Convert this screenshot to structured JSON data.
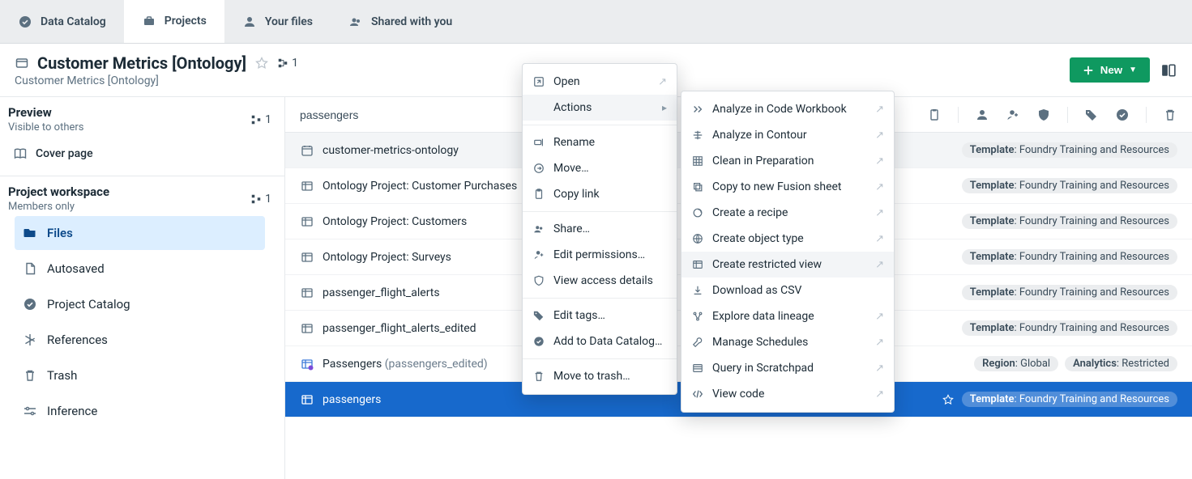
{
  "top_tabs": {
    "data_catalog": "Data Catalog",
    "projects": "Projects",
    "your_files": "Your files",
    "shared": "Shared with you"
  },
  "header": {
    "title": "Customer Metrics [Ontology]",
    "breadcrumb": "Customer Metrics [Ontology]",
    "forks_count": "1",
    "new_label": "New"
  },
  "sidebar": {
    "preview_heading": "Preview",
    "preview_sub": "Visible to others",
    "preview_chip": "1",
    "cover_page": "Cover page",
    "workspace_heading": "Project workspace",
    "workspace_sub": "Members only",
    "workspace_chip": "1",
    "nav": {
      "files": "Files",
      "autosaved": "Autosaved",
      "catalog": "Project Catalog",
      "references": "References",
      "trash": "Trash",
      "inference": "Inference"
    }
  },
  "content": {
    "search_placeholder": "passengers",
    "template_prefix": "Template",
    "template_value": "Foundry Training and Resources",
    "region_prefix": "Region",
    "region_value": "Global",
    "analytics_prefix": "Analytics",
    "analytics_value": "Restricted",
    "rows": {
      "r0": "customer-metrics-ontology",
      "r1": "Ontology Project: Customer Purchases",
      "r2": "Ontology Project: Customers",
      "r3": "Ontology Project: Surveys",
      "r4": "passenger_flight_alerts",
      "r5": "passenger_flight_alerts_edited",
      "r6_a": "Passengers ",
      "r6_b": "(passengers_edited)",
      "r7": "passengers"
    }
  },
  "ctx": {
    "open": "Open",
    "actions": "Actions",
    "rename": "Rename",
    "move": "Move…",
    "copy_link": "Copy link",
    "share": "Share…",
    "edit_permissions": "Edit permissions…",
    "view_access": "View access details",
    "edit_tags": "Edit tags…",
    "add_catalog": "Add to Data Catalog…",
    "move_trash": "Move to trash…"
  },
  "sub": {
    "code_workbook": "Analyze in Code Workbook",
    "contour": "Analyze in Contour",
    "prep": "Clean in Preparation",
    "fusion": "Copy to new Fusion sheet",
    "recipe": "Create a recipe",
    "object_type": "Create object type",
    "restricted_view": "Create restricted view",
    "csv": "Download as CSV",
    "lineage": "Explore data lineage",
    "schedules": "Manage Schedules",
    "scratchpad": "Query in Scratchpad",
    "view_code": "View code"
  }
}
